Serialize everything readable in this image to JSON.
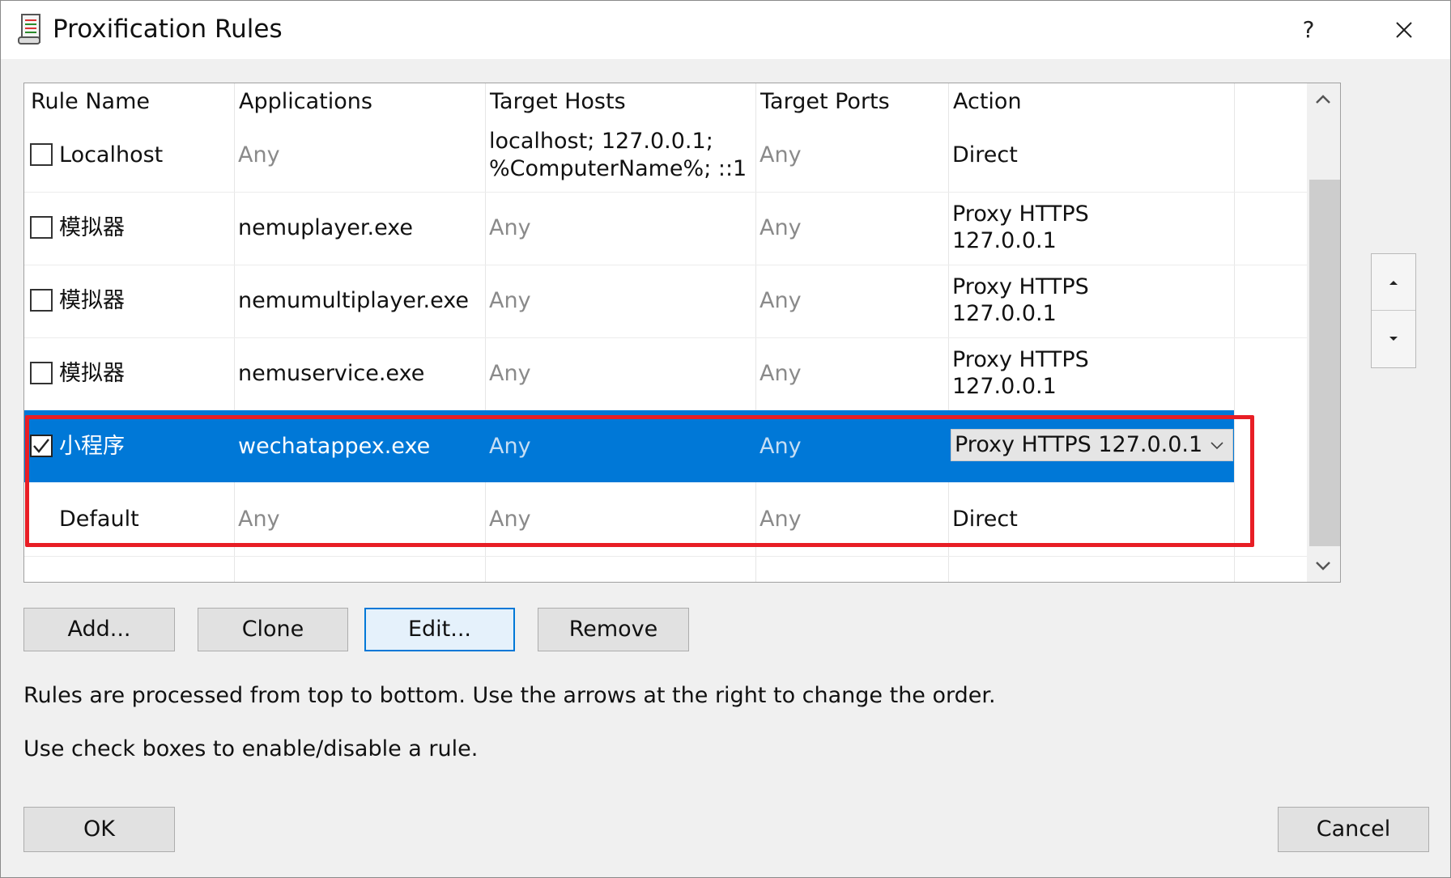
{
  "window": {
    "title": "Proxification Rules",
    "help": "?",
    "icon": "rules-scroll-icon",
    "close_icon": "close-icon"
  },
  "table": {
    "headers": [
      "Rule Name",
      "Applications",
      "Target Hosts",
      "Target Ports",
      "Action"
    ],
    "rows": [
      {
        "name": "Localhost",
        "checked": false,
        "applications": "Any",
        "target_hosts": [
          "localhost; 127.0.0.1;",
          "%ComputerName%; ::1"
        ],
        "target_ports": "Any",
        "action": "Direct"
      },
      {
        "name": "模拟器",
        "checked": false,
        "applications": "nemuplayer.exe",
        "target_hosts": "Any",
        "target_ports": "Any",
        "action": [
          "Proxy HTTPS",
          "127.0.0.1"
        ]
      },
      {
        "name": "模拟器",
        "checked": false,
        "applications": "nemumultiplayer.exe",
        "target_hosts": "Any",
        "target_ports": "Any",
        "action": [
          "Proxy HTTPS",
          "127.0.0.1"
        ]
      },
      {
        "name": "模拟器",
        "checked": false,
        "applications": "nemuservice.exe",
        "target_hosts": "Any",
        "target_ports": "Any",
        "action": [
          "Proxy HTTPS",
          "127.0.0.1"
        ]
      },
      {
        "name": "小程序",
        "checked": true,
        "selected": true,
        "applications": "wechatappex.exe",
        "target_hosts": "Any",
        "target_ports": "Any",
        "action": "Proxy HTTPS 127.0.0.1"
      },
      {
        "name": "Default",
        "applications": "Any",
        "target_hosts": "Any",
        "target_ports": "Any",
        "action": "Direct"
      }
    ]
  },
  "buttons": {
    "add": "Add...",
    "clone": "Clone",
    "edit": "Edit...",
    "remove": "Remove",
    "ok": "OK",
    "cancel": "Cancel"
  },
  "hints": {
    "line1": "Rules are processed from top to bottom. Use the arrows at the right to change the order.",
    "line2": "Use check boxes to enable/disable a rule."
  },
  "colors": {
    "selection": "#0078d7",
    "highlight_box": "#e81e25"
  }
}
